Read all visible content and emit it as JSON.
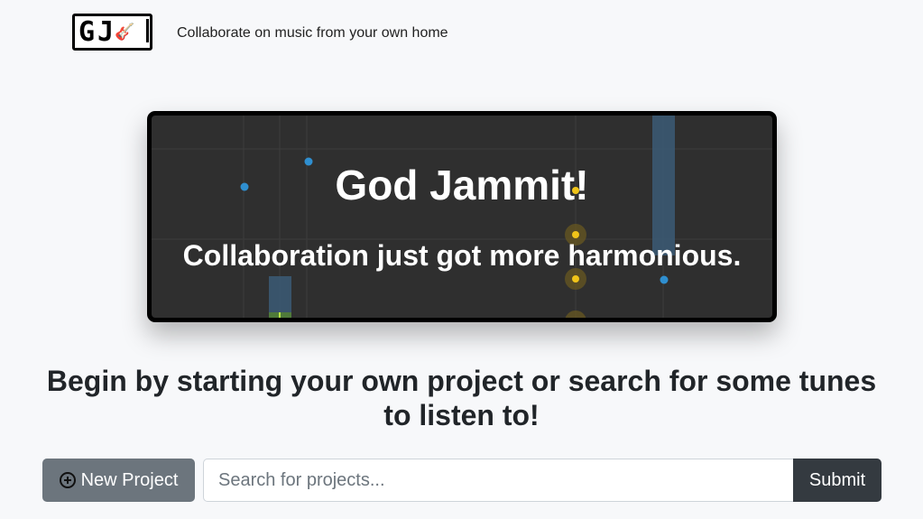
{
  "header": {
    "logo_text": "GJ",
    "logo_icon": "guitar-icon",
    "tagline": "Collaborate on music from your own home"
  },
  "hero": {
    "title": "God Jammit!",
    "subtitle": "Collaboration just got more harmonious."
  },
  "cta": {
    "text": "Begin by starting your own project or search for some tunes to listen to!"
  },
  "actions": {
    "new_project_label": "New Project",
    "new_project_icon": "plus-circle-icon",
    "search_placeholder": "Search for projects...",
    "submit_label": "Submit"
  },
  "colors": {
    "hero_bg": "#2f2f2f",
    "note_blue": "#2f8fd0",
    "note_yellow": "#f0c419",
    "new_project_bg": "#6c757d",
    "submit_bg": "#343a40"
  }
}
